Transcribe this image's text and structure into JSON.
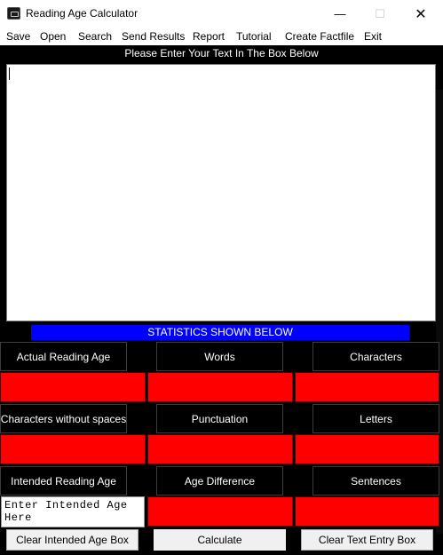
{
  "window": {
    "title": "Reading Age Calculator",
    "minimize": "—",
    "maximize": "☐",
    "close": "✕"
  },
  "menu": [
    "Save",
    "Open",
    "Search",
    "Send Results",
    "Report",
    "Tutorial",
    "Create Factfile",
    "Exit"
  ],
  "prompt": "Please Enter Your Text In The Box Below",
  "text_entry": "",
  "stats_banner": "STATISTICS SHOWN BELOW",
  "rows": [
    {
      "labels": [
        "Actual Reading Age",
        "Words",
        "Characters"
      ]
    },
    {
      "labels": [
        "Characters without spaces",
        "Punctuation",
        "Letters"
      ]
    },
    {
      "labels": [
        "Intended Reading Age",
        "Age Difference",
        "Sentences"
      ]
    }
  ],
  "age_input": {
    "placeholder": "Enter Intended Age Here",
    "value": "Enter Intended Age Here"
  },
  "buttons": {
    "clear_age": "Clear Intended Age Box",
    "calculate": "Calculate",
    "clear_text": "Clear Text Entry Box"
  },
  "colors": {
    "background": "#000000",
    "result_box": "#ff0000",
    "banner": "#0000ff"
  }
}
